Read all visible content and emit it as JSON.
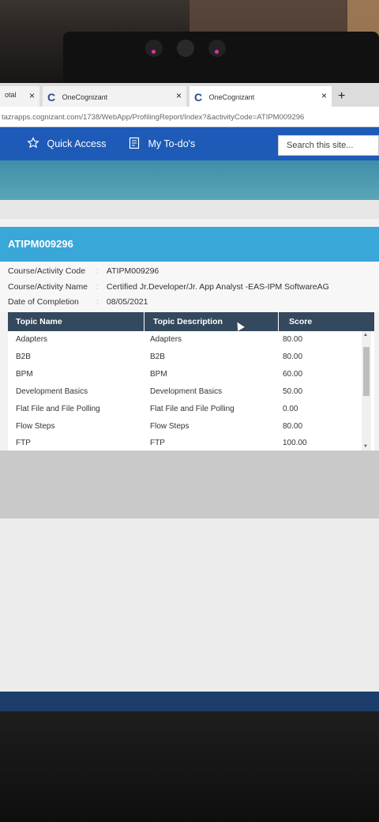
{
  "browser": {
    "tabs": [
      {
        "label": "otal"
      },
      {
        "label": "OneCognizant"
      },
      {
        "label": "OneCognizant"
      }
    ],
    "close_glyph": "×",
    "new_tab_glyph": "+",
    "address": "tazrapps.cognizant.com/1738/WebApp/ProfilingReport/Index?&activityCode=ATIPM009296"
  },
  "nav": {
    "quick_access": "Quick Access",
    "todo": "My To-do's",
    "search_placeholder": "Search this site..."
  },
  "activity": {
    "header": "ATIPM009296",
    "details": [
      {
        "key": "Course/Activity Code",
        "value": "ATIPM009296"
      },
      {
        "key": "Course/Activity Name",
        "value": "Certified Jr.Developer/Jr. App Analyst -EAS-IPM SoftwareAG"
      },
      {
        "key": "Date of Completion",
        "value": "08/05/2021"
      }
    ]
  },
  "table": {
    "headers": [
      "Topic Name",
      "Topic Description",
      "Score"
    ],
    "rows": [
      [
        "Adapters",
        "Adapters",
        "80.00"
      ],
      [
        "B2B",
        "B2B",
        "80.00"
      ],
      [
        "BPM",
        "BPM",
        "60.00"
      ],
      [
        "Development Basics",
        "Development Basics",
        "50.00"
      ],
      [
        "Flat File and File Polling",
        "Flat File and File Polling",
        "0.00"
      ],
      [
        "Flow Steps",
        "Flow Steps",
        "80.00"
      ],
      [
        "FTP",
        "FTP",
        "100.00"
      ]
    ]
  },
  "colors": {
    "nav_blue": "#1e5bb8",
    "header_blue": "#3aa7d9",
    "table_header": "#34495e"
  }
}
